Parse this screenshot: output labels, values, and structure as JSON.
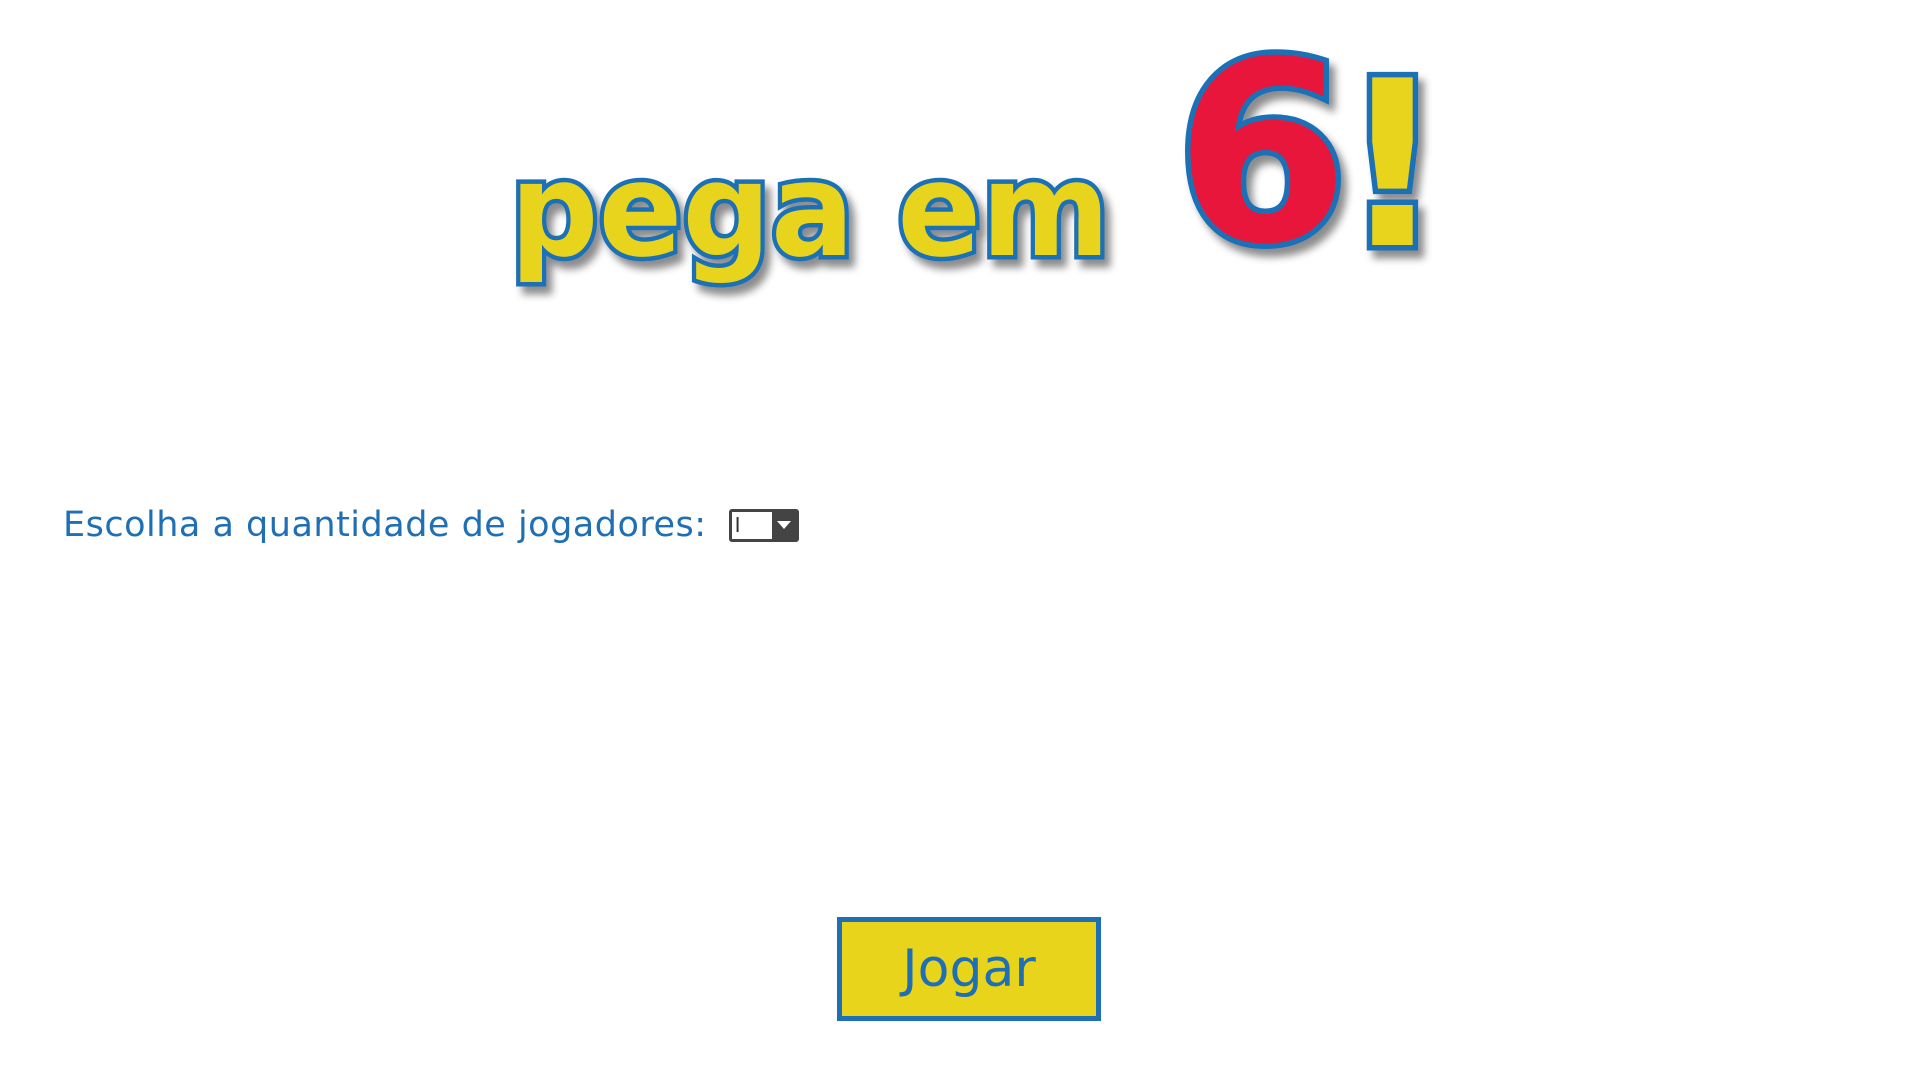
{
  "title": {
    "prefix": "pega em",
    "number": "6",
    "exclaim": "!"
  },
  "players": {
    "label": "Escolha a quantidade de jogadores:",
    "selected": "I"
  },
  "play_button": {
    "label": "Jogar"
  },
  "colors": {
    "yellow": "#e8d41a",
    "blue": "#1f6fb5",
    "red": "#e8173a",
    "text_blue": "#1f6fb5"
  }
}
